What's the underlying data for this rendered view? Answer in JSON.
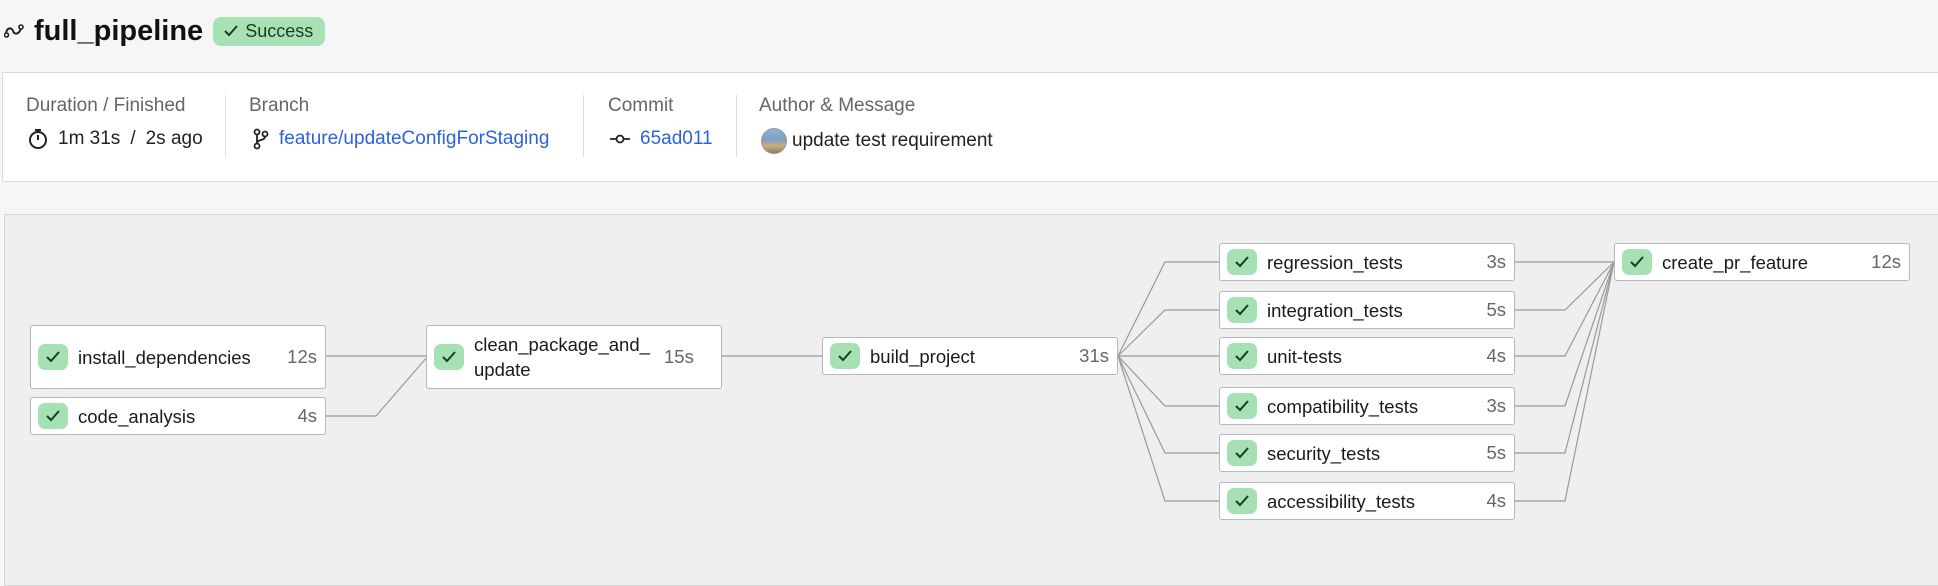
{
  "header": {
    "title": "full_pipeline",
    "status": "Success"
  },
  "info": {
    "duration_label": "Duration / Finished",
    "duration": "1m 31s",
    "duration_sep": "/",
    "finished": "2s ago",
    "branch_label": "Branch",
    "branch": "feature/updateConfigForStaging",
    "commit_label": "Commit",
    "commit": "65ad011",
    "author_label": "Author & Message",
    "message": "update test requirement"
  },
  "jobs": {
    "install_dependencies": {
      "name": "install_dependencies",
      "duration": "12s"
    },
    "code_analysis": {
      "name": "code_analysis",
      "duration": "4s"
    },
    "clean_package": {
      "name": "clean_package_and_ update",
      "duration": "15s"
    },
    "build_project": {
      "name": "build_project",
      "duration": "31s"
    },
    "regression_tests": {
      "name": "regression_tests",
      "duration": "3s"
    },
    "integration_tests": {
      "name": "integration_tests",
      "duration": "5s"
    },
    "unit_tests": {
      "name": "unit-tests",
      "duration": "4s"
    },
    "compatibility_tests": {
      "name": "compatibility_tests",
      "duration": "3s"
    },
    "security_tests": {
      "name": "security_tests",
      "duration": "5s"
    },
    "accessibility_tests": {
      "name": "accessibility_tests",
      "duration": "4s"
    },
    "create_pr_feature": {
      "name": "create_pr_feature",
      "duration": "12s"
    }
  },
  "colors": {
    "success": "#a8e2b4",
    "link": "#2d63d8"
  },
  "icons": {
    "pipeline": "pipeline-icon",
    "check": "check-icon",
    "timer": "timer-icon",
    "branch": "git-branch-icon",
    "commit": "git-commit-icon"
  }
}
